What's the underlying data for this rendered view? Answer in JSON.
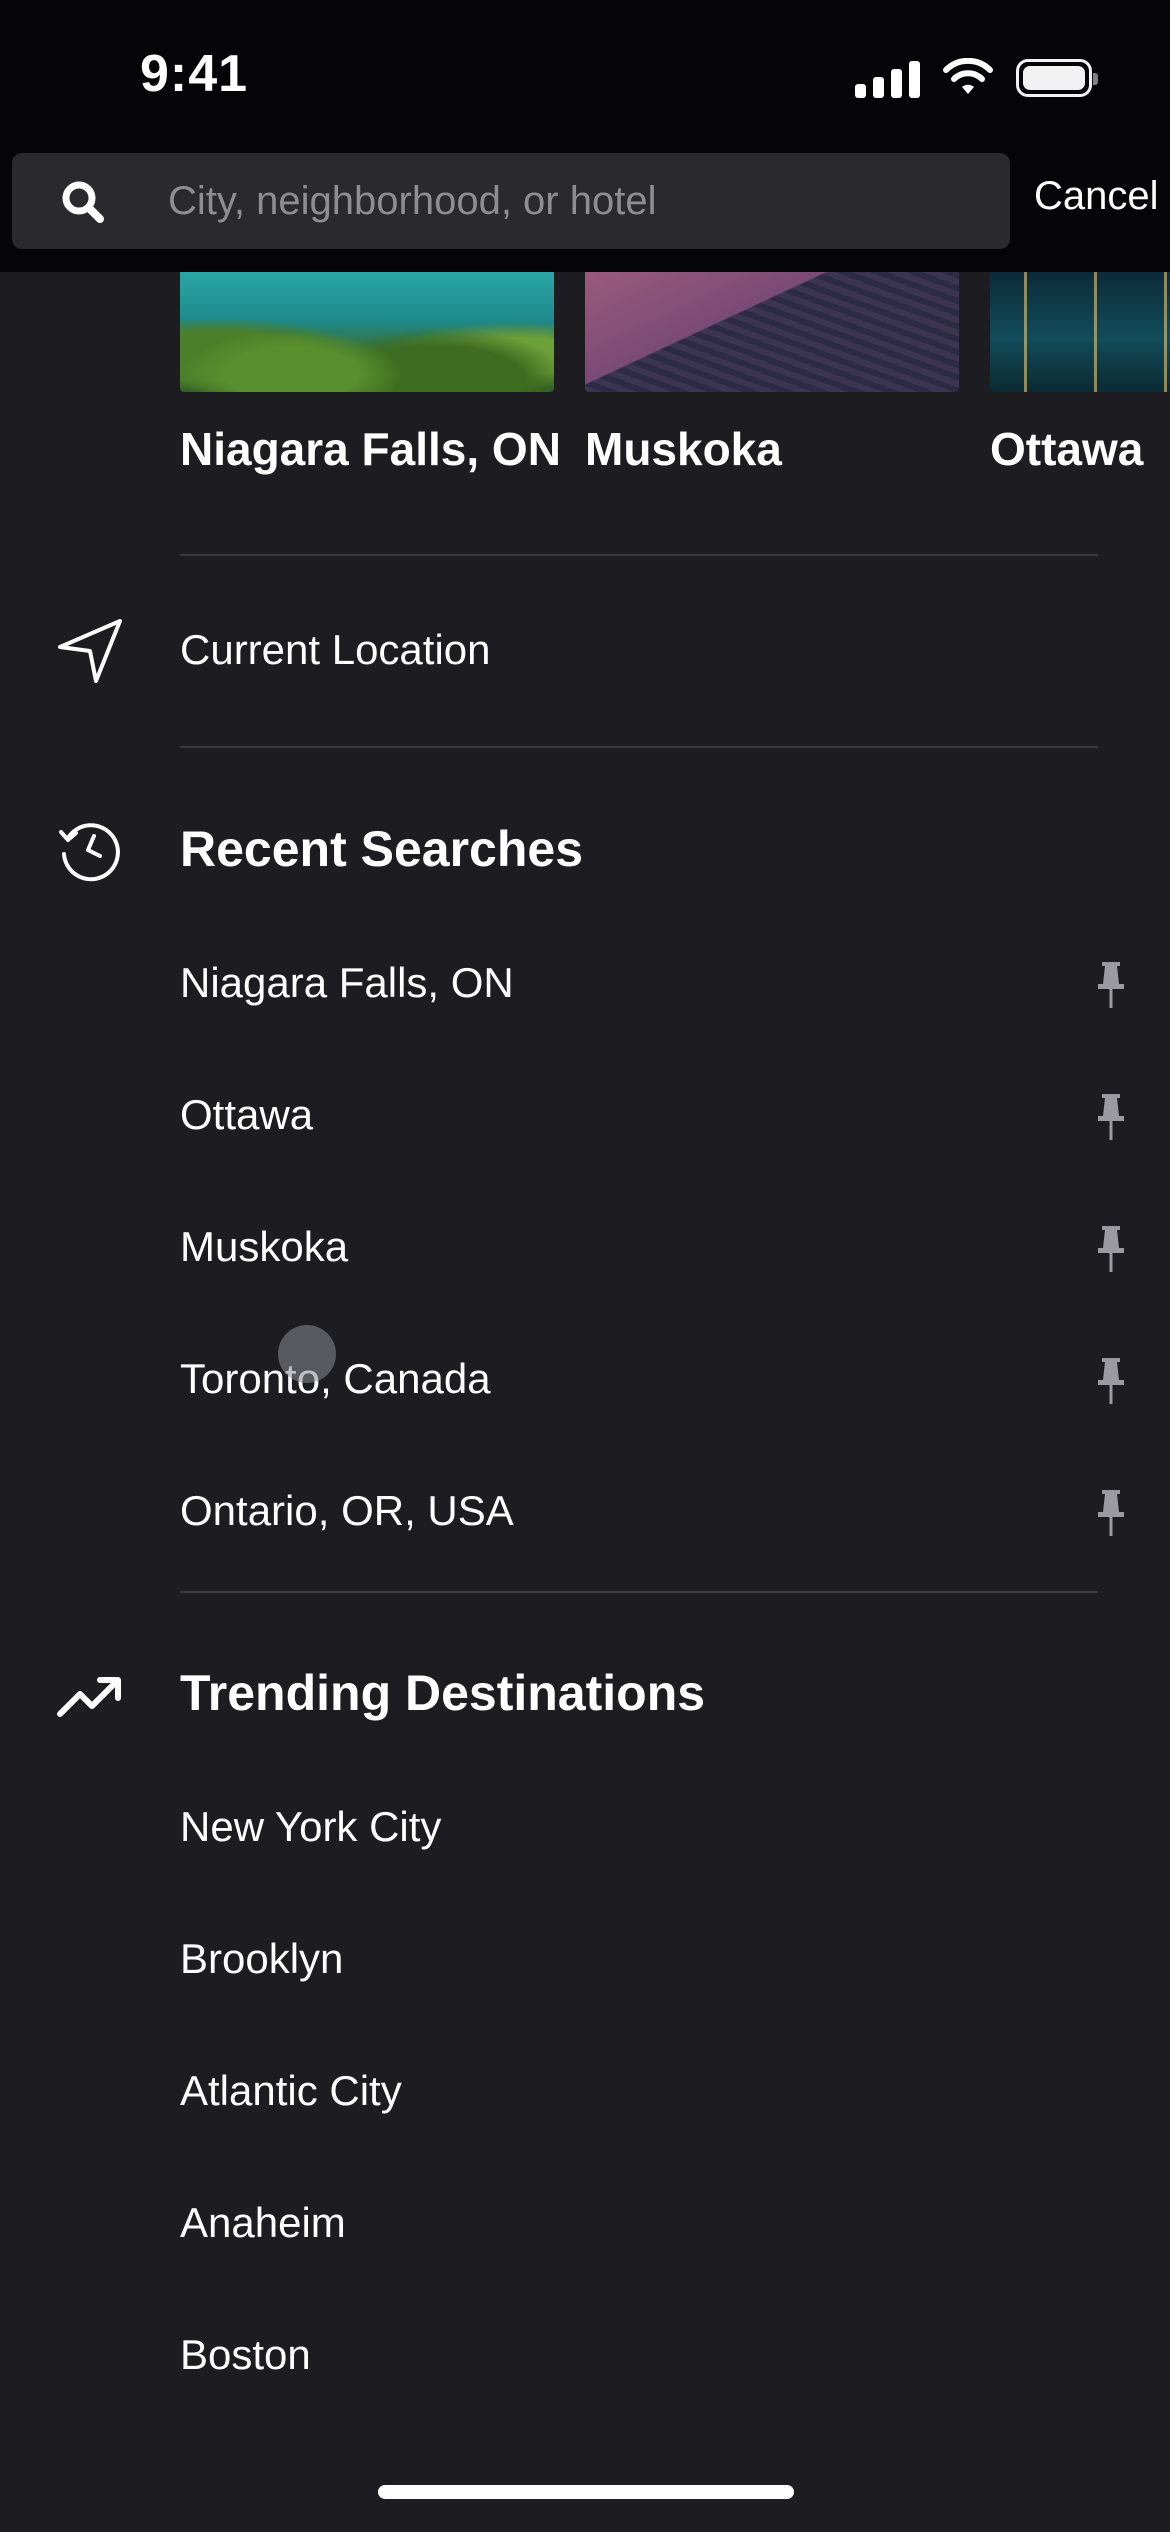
{
  "status_bar": {
    "time": "9:41"
  },
  "search": {
    "placeholder": "City, neighborhood, or hotel",
    "value": "",
    "cancel_label": "Cancel"
  },
  "carousel": [
    {
      "title": "Niagara Falls, ON"
    },
    {
      "title": "Muskoka"
    },
    {
      "title": "Ottawa"
    }
  ],
  "current_location": {
    "label": "Current Location"
  },
  "recent_searches": {
    "title": "Recent Searches",
    "items": [
      {
        "label": "Niagara Falls, ON"
      },
      {
        "label": "Ottawa"
      },
      {
        "label": "Muskoka"
      },
      {
        "label": "Toronto, Canada"
      },
      {
        "label": "Ontario, OR, USA"
      }
    ]
  },
  "trending": {
    "title": "Trending Destinations",
    "items": [
      {
        "label": "New York City"
      },
      {
        "label": "Brooklyn"
      },
      {
        "label": "Atlantic City"
      },
      {
        "label": "Anaheim"
      },
      {
        "label": "Boston"
      }
    ]
  },
  "icons": {
    "search": "search-icon",
    "location": "location-arrow-icon",
    "history": "history-clock-icon",
    "trending": "trending-up-icon",
    "pin": "pin-icon"
  },
  "colors": {
    "background": "#1c1c21",
    "header": "#050507",
    "search_field": "#29292e",
    "placeholder": "#8d8d93",
    "divider": "#3a3a40",
    "pin": "#9a9aa0"
  }
}
